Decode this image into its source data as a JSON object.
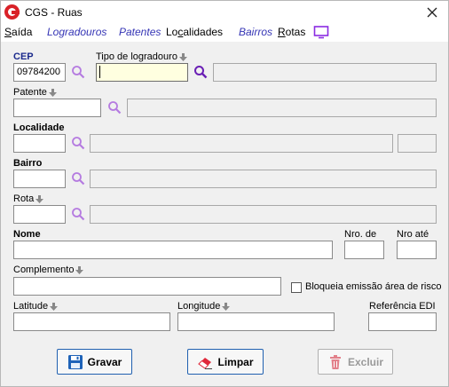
{
  "window": {
    "title": "CGS - Ruas"
  },
  "menu": {
    "saida": "Saída",
    "logradouros": "Logradouros",
    "patentes": "Patentes",
    "localidades": "Localidades",
    "bairros": "Bairros",
    "rotas": "Rotas"
  },
  "form": {
    "cep": {
      "label": "CEP",
      "value": "09784200"
    },
    "tipo_logradouro": {
      "label": "Tipo de logradouro",
      "value": "",
      "description": ""
    },
    "patente": {
      "label": "Patente",
      "value": "",
      "description": ""
    },
    "localidade": {
      "label": "Localidade",
      "value": "",
      "description": "",
      "extra": ""
    },
    "bairro": {
      "label": "Bairro",
      "value": "",
      "description": ""
    },
    "rota": {
      "label": "Rota",
      "value": "",
      "description": ""
    },
    "nome": {
      "label": "Nome",
      "value": ""
    },
    "nro_de": {
      "label": "Nro. de",
      "value": ""
    },
    "nro_ate": {
      "label": "Nro até",
      "value": ""
    },
    "complemento": {
      "label": "Complemento",
      "value": ""
    },
    "bloqueia": {
      "label": "Bloqueia emissão área de risco",
      "checked": false
    },
    "latitude": {
      "label": "Latitude",
      "value": ""
    },
    "longitude": {
      "label": "Longitude",
      "value": ""
    },
    "referencia_edi": {
      "label": "Referência EDI",
      "value": ""
    }
  },
  "buttons": {
    "gravar": "Gravar",
    "limpar": "Limpar",
    "excluir": "Excluir"
  },
  "colors": {
    "accent_blue": "#1b2a8c",
    "menu_link": "#3535b5",
    "focus_bg": "#ffffe0",
    "logo_red": "#d92128",
    "search_purple": "#7a3fc4"
  },
  "icons": {
    "logo": "cgs-logo-icon",
    "close": "close-icon",
    "monitor": "monitor-icon",
    "search": "magnifier-icon",
    "sort": "down-arrow-icon",
    "save": "floppy-disk-icon",
    "clear": "eraser-icon",
    "delete": "trash-icon"
  }
}
